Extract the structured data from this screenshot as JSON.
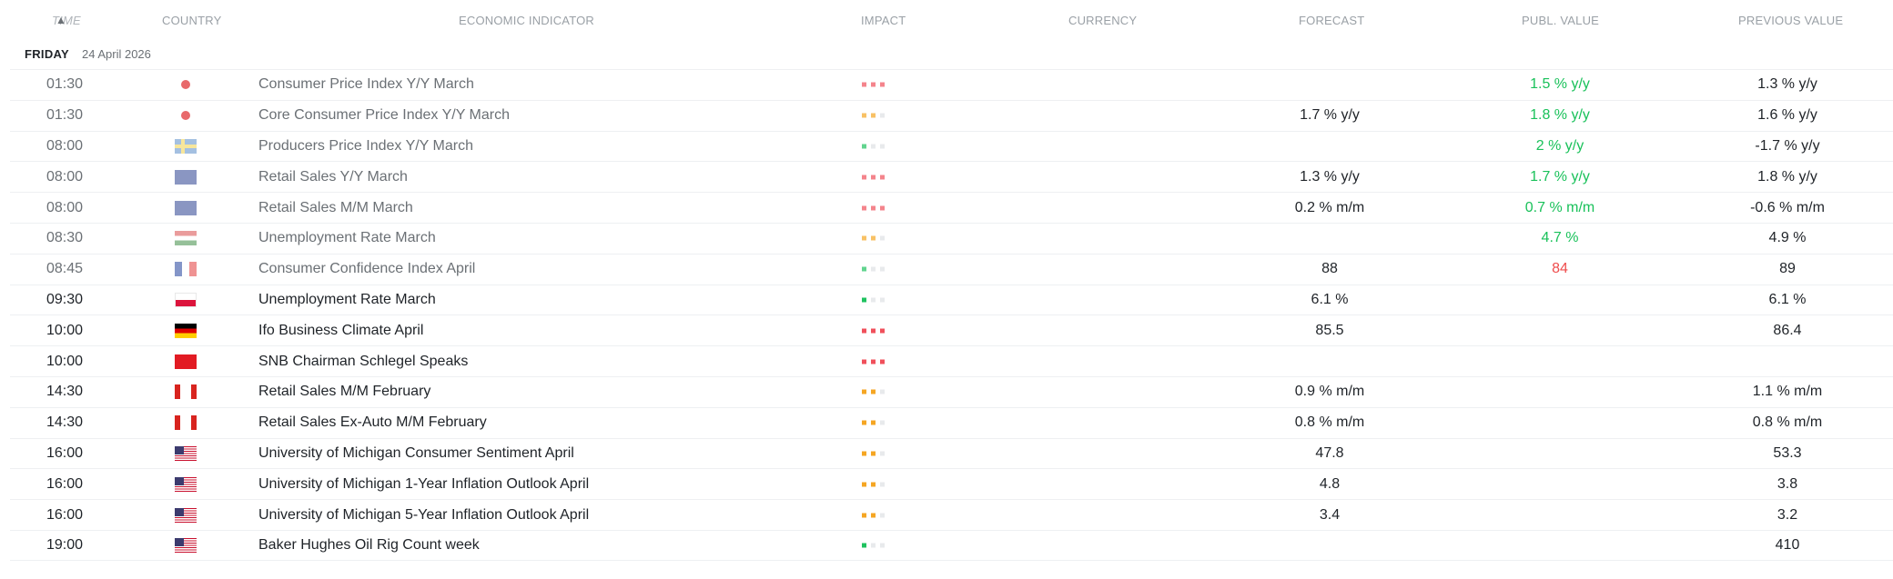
{
  "header": {
    "time": "TIME",
    "country": "COUNTRY",
    "indicator": "ECONOMIC INDICATOR",
    "impact": "IMPACT",
    "currency": "CURRENCY",
    "forecast": "FORECAST",
    "published": "PUBL. VALUE",
    "previous": "PREVIOUS VALUE",
    "sort_icon": "sort-ascending-icon"
  },
  "date_header": {
    "day": "FRIDAY",
    "date": "24 April 2026"
  },
  "impact_colors": {
    "high": "#f0505b",
    "medium": "#f5a623",
    "low": "#1fc25f",
    "inactive": "#e8eaec"
  },
  "rows": [
    {
      "time": "01:30",
      "country_icon": "red-dot-icon",
      "indicator": "Consumer Price Index Y/Y March",
      "impact": "high",
      "forecast": "",
      "published": "1.5 % y/y",
      "previous": "1.3 % y/y",
      "past": true
    },
    {
      "time": "01:30",
      "country_icon": "red-dot-icon",
      "indicator": "Core Consumer Price Index Y/Y March",
      "impact": "medium",
      "forecast": "1.7 % y/y",
      "published": "1.8 % y/y",
      "previous": "1.6 % y/y",
      "past": true
    },
    {
      "time": "08:00",
      "country_icon": "sweden-flag-icon",
      "indicator": "Producers Price Index Y/Y March",
      "impact": "low",
      "forecast": "",
      "published": "2 % y/y",
      "previous": "-1.7 % y/y",
      "past": true
    },
    {
      "time": "08:00",
      "country_icon": "uk-flag-icon",
      "indicator": "Retail Sales Y/Y March",
      "impact": "high",
      "forecast": "1.3 % y/y",
      "published": "1.7 % y/y",
      "previous": "1.8 % y/y",
      "past": true
    },
    {
      "time": "08:00",
      "country_icon": "uk-flag-icon",
      "indicator": "Retail Sales M/M March",
      "impact": "high",
      "forecast": "0.2 % m/m",
      "published": "0.7 % m/m",
      "previous": "-0.6 % m/m",
      "past": true
    },
    {
      "time": "08:30",
      "country_icon": "hungary-flag-icon",
      "indicator": "Unemployment Rate March",
      "impact": "medium",
      "forecast": "",
      "published": "4.7 %",
      "previous": "4.9 %",
      "past": true
    },
    {
      "time": "08:45",
      "country_icon": "france-flag-icon",
      "indicator": "Consumer Confidence Index April",
      "impact": "low",
      "forecast": "88",
      "published": "84",
      "previous": "89",
      "past": true
    },
    {
      "time": "09:30",
      "country_icon": "poland-flag-icon",
      "indicator": "Unemployment Rate March",
      "impact": "low",
      "forecast": "6.1 %",
      "published": "",
      "previous": "6.1 %",
      "past": false
    },
    {
      "time": "10:00",
      "country_icon": "germany-flag-icon",
      "indicator": "Ifo Business Climate April",
      "impact": "high",
      "forecast": "85.5",
      "published": "",
      "previous": "86.4",
      "past": false
    },
    {
      "time": "10:00",
      "country_icon": "switzerland-flag-icon",
      "indicator": "SNB Chairman Schlegel Speaks",
      "impact": "high",
      "forecast": "",
      "published": "",
      "previous": "",
      "past": false
    },
    {
      "time": "14:30",
      "country_icon": "canada-flag-icon",
      "indicator": "Retail Sales M/M February",
      "impact": "medium",
      "forecast": "0.9 % m/m",
      "published": "",
      "previous": "1.1 % m/m",
      "past": false
    },
    {
      "time": "14:30",
      "country_icon": "canada-flag-icon",
      "indicator": "Retail Sales Ex-Auto M/M February",
      "impact": "medium",
      "forecast": "0.8 % m/m",
      "published": "",
      "previous": "0.8 % m/m",
      "past": false
    },
    {
      "time": "16:00",
      "country_icon": "usa-flag-icon",
      "indicator": "University of Michigan Consumer Sentiment April",
      "impact": "medium",
      "forecast": "47.8",
      "published": "",
      "previous": "53.3",
      "past": false
    },
    {
      "time": "16:00",
      "country_icon": "usa-flag-icon",
      "indicator": "University of Michigan 1-Year Inflation Outlook April",
      "impact": "medium",
      "forecast": "4.8",
      "published": "",
      "previous": "3.8",
      "past": false
    },
    {
      "time": "16:00",
      "country_icon": "usa-flag-icon",
      "indicator": "University of Michigan 5-Year Inflation Outlook April",
      "impact": "medium",
      "forecast": "3.4",
      "published": "",
      "previous": "3.2",
      "past": false
    },
    {
      "time": "19:00",
      "country_icon": "usa-flag-icon",
      "indicator": "Baker Hughes Oil Rig Count week",
      "impact": "low",
      "forecast": "",
      "published": "",
      "previous": "410",
      "past": false
    }
  ]
}
